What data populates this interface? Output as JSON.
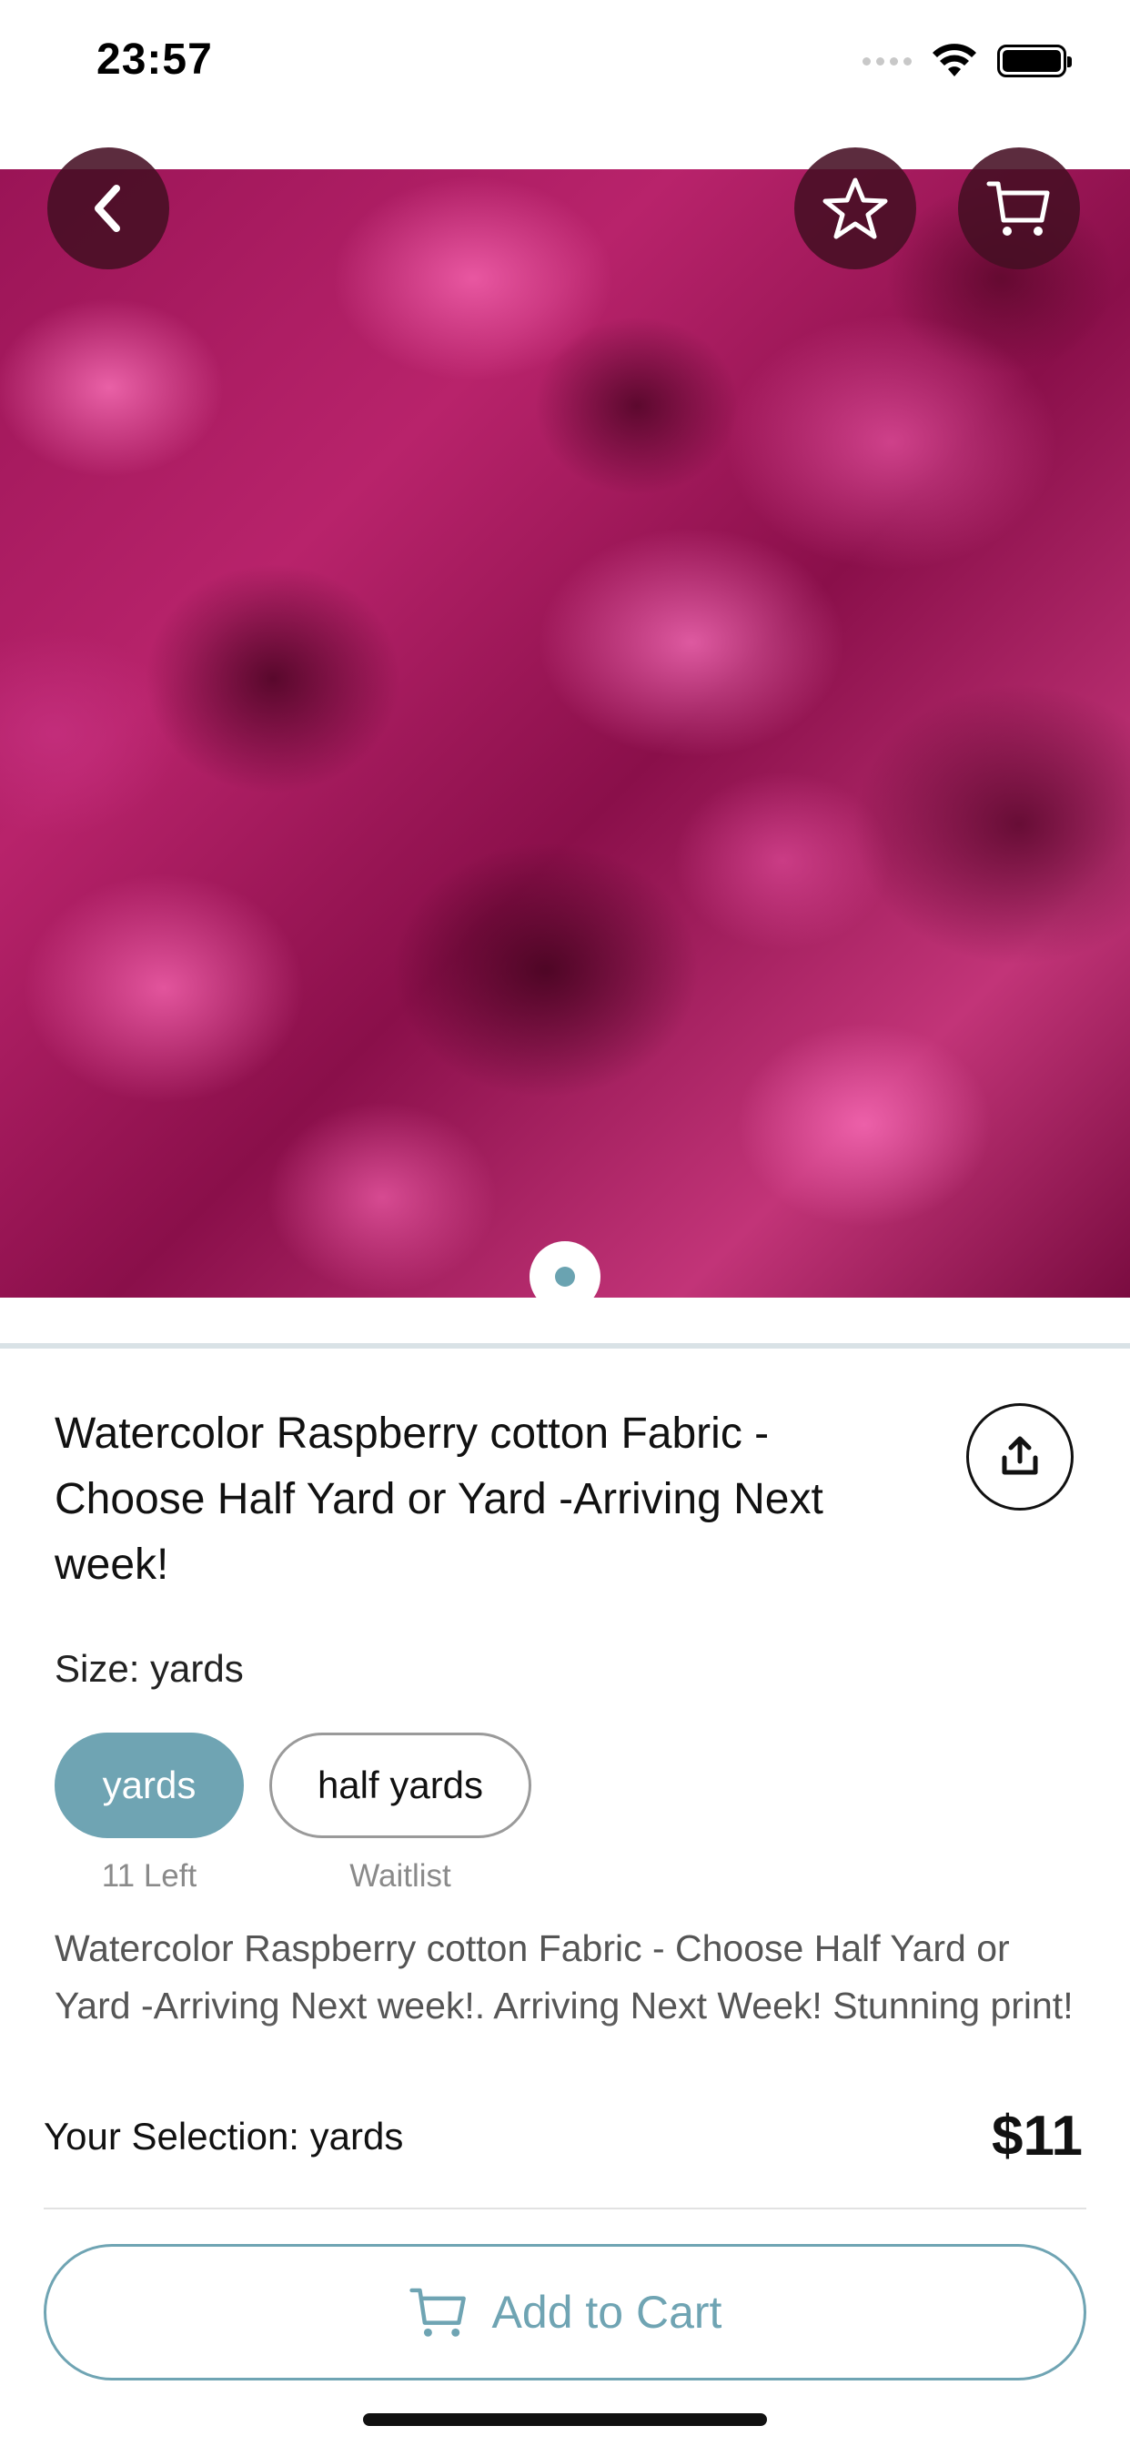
{
  "status_bar": {
    "time": "23:57",
    "icons": [
      "cellular-signal-icon",
      "wifi-icon",
      "battery-icon"
    ]
  },
  "hero": {
    "image_description_icon": "fabric-photo",
    "colors": {
      "base": "#b8236b",
      "dark": "#5a0726",
      "light": "#ff78be"
    },
    "page_indicator": {
      "current": 1,
      "total": 1
    },
    "buttons": {
      "back_icon": "chevron-left-icon",
      "favorite_icon": "star-icon",
      "cart_icon": "cart-icon"
    }
  },
  "product": {
    "title": "Watercolor Raspberry cotton Fabric - Choose Half Yard or Yard -Arriving Next week!",
    "share_icon": "share-icon",
    "size_label": "Size:",
    "size_value": "yards",
    "variants": [
      {
        "label": "yards",
        "note": "11 Left",
        "selected": true
      },
      {
        "label": "half yards",
        "note": "Waitlist",
        "selected": false
      }
    ],
    "description": "Watercolor Raspberry cotton Fabric - Choose Half Yard or Yard -Arriving Next week!. Arriving Next Week! Stunning print!"
  },
  "bottom_bar": {
    "selection_label": "Your Selection:",
    "selection_value": "yards",
    "price": "$11",
    "add_to_cart_label": "Add to Cart",
    "add_to_cart_icon": "cart-icon"
  },
  "theme": {
    "accent": "#6fa4b3",
    "divider": "#d9e2e6"
  }
}
